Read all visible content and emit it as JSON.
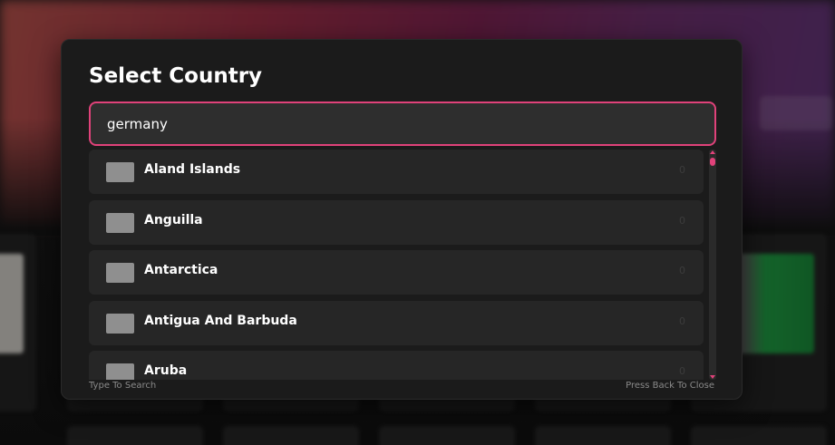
{
  "modal": {
    "title": "Select Country",
    "search": {
      "value": "germany",
      "placeholder": ""
    },
    "countries": [
      {
        "name": "Aland Islands",
        "count": "0",
        "flag_icon": "flag-placeholder-icon"
      },
      {
        "name": "Anguilla",
        "count": "0",
        "flag_icon": "flag-placeholder-icon"
      },
      {
        "name": "Antarctica",
        "count": "0",
        "flag_icon": "flag-placeholder-icon"
      },
      {
        "name": "Antigua And Barbuda",
        "count": "0",
        "flag_icon": "flag-placeholder-icon"
      },
      {
        "name": "Aruba",
        "count": "0",
        "flag_icon": "flag-placeholder-icon"
      }
    ],
    "hint_left": "Type To Search",
    "hint_right": "Press Back To Close"
  },
  "colors": {
    "accent": "#e0427a",
    "modal_bg": "#1b1b1b",
    "item_bg": "#262626",
    "input_bg": "#2e2e2e"
  }
}
